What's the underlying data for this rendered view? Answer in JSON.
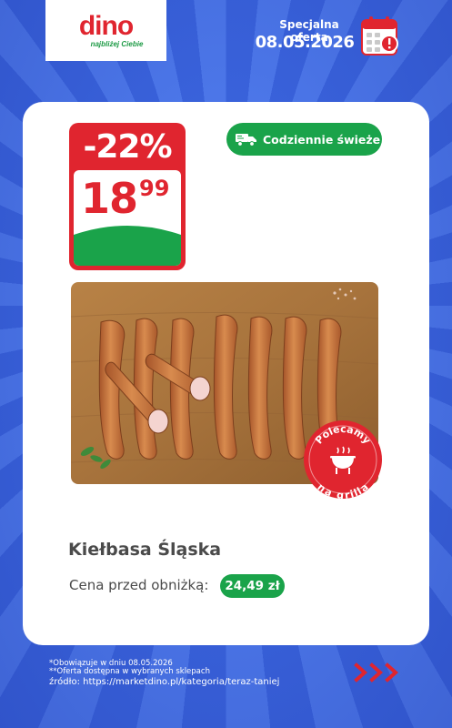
{
  "header": {
    "logo_text": "dino",
    "logo_tagline": "najbliżej Ciebie",
    "offer_label": "Specjalna oferta",
    "offer_date": "08.05.2026",
    "calendar_icon": "calendar-alert-icon"
  },
  "price_tag": {
    "discount": "-22%",
    "price_main": "18",
    "price_cents": "99"
  },
  "fresh_badge": {
    "label": "Codziennie świeże",
    "icon": "delivery-truck-icon"
  },
  "product": {
    "image": "sausages-on-cutting-board",
    "name": "Kiełbasa Śląska",
    "old_price_label": "Cena przed obniżką:",
    "old_price_value": "24,49 zł"
  },
  "grill_badge": {
    "top_text": "Polecamy",
    "bottom_text": "na grilla",
    "icon": "grill-icon"
  },
  "footer": {
    "note_1": "*Obowiązuje w dniu 08.05.2026",
    "note_2": "**Oferta dostępna w wybranych sklepach",
    "source": "źródło: https://marketdino.pl/kategoria/teraz-taniej",
    "arrows_icon": "triple-chevron-right-icon"
  },
  "colors": {
    "background_blue": "#3f68e0",
    "brand_red": "#e0252f",
    "brand_green": "#1aa34a",
    "card_white": "#ffffff",
    "text_gray": "#4a4a4a"
  }
}
